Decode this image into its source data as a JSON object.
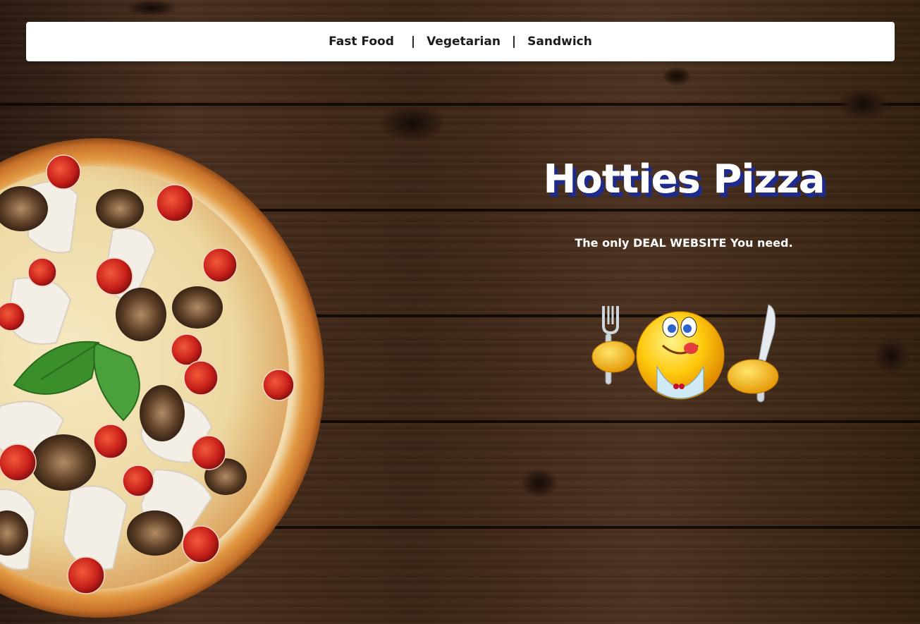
{
  "nav": {
    "items": [
      {
        "label": "Fast Food"
      },
      {
        "label": "Vegetarian"
      },
      {
        "label": "Sandwich"
      }
    ],
    "separator": "|"
  },
  "hero": {
    "title": "Hotties Pizza",
    "tagline": "The only DEAL WEBSITE You need."
  },
  "images": {
    "background": "dark-wood-planks",
    "pizza": "chicken-mushroom-tomato-basil-pizza",
    "mascot": "hungry-smiley-with-fork-knife-bib"
  },
  "colors": {
    "title_shadow": "#1e2b8c",
    "navbar_bg": "#ffffff",
    "text_on_dark": "#ffffff"
  }
}
